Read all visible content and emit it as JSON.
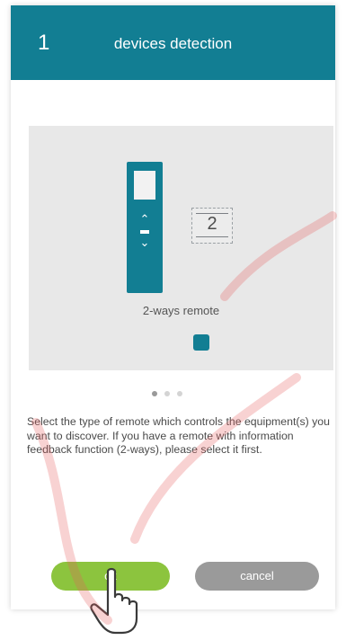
{
  "header": {
    "step": "1",
    "title": "devices detection"
  },
  "panel": {
    "remote_label": "2-ways remote",
    "badge_number": "2"
  },
  "carousel": {
    "page_count": 3,
    "active_page": 1
  },
  "description": "Select the type of remote which controls the equipment(s) you want to discover. If you have a remote with information feedback function (2-ways), please select it first.",
  "buttons": {
    "ok_label": "ok",
    "cancel_label": "cancel"
  },
  "colors": {
    "header": "#127e93",
    "remote": "#127e93",
    "ok": "#8cc43e",
    "cancel": "#9a9a9a",
    "panel": "#e8e8e8"
  },
  "icons": {
    "remote": "2-way-remote-icon",
    "pointer": "hand-pointer-icon"
  }
}
